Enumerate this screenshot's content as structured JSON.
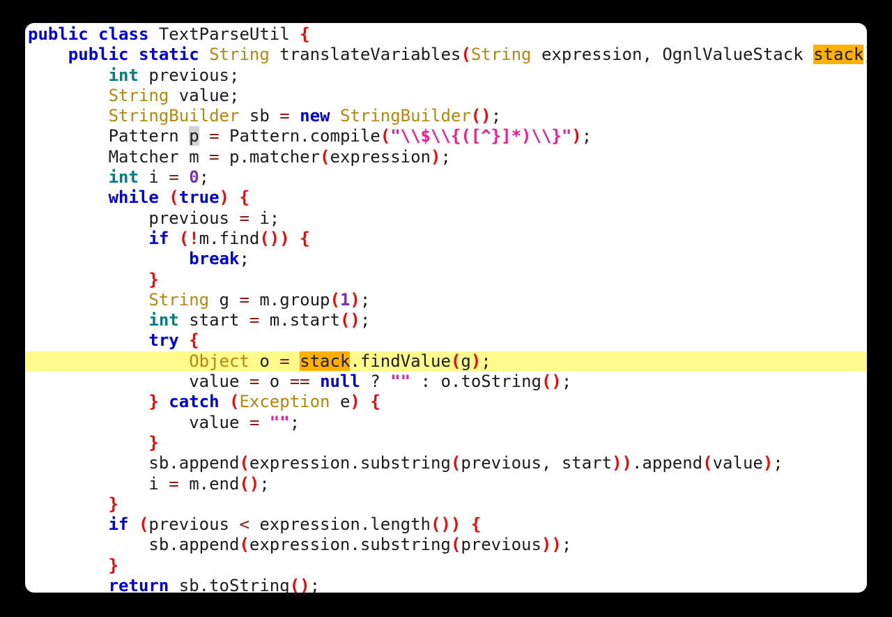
{
  "editor": {
    "language": "Java",
    "class_name": "TextParseUtil",
    "method_name": "translateVariables",
    "caret_character": "p",
    "occurrence_token": "stack",
    "colors": {
      "background": "#000000",
      "card_background": "#ffffff",
      "keyword": "#0000e6",
      "type": "#b8860b",
      "primitive": "#008080",
      "punctuation": "#ff0000",
      "operator": "#8b1a1a",
      "string": "#ff1493",
      "number": "#7b2fbe",
      "plain_text": "#1c1c1c",
      "current_line_highlight": "#fffa8c",
      "occurrence_highlight": "#ffb000",
      "caret_block": "#d2d2d2"
    }
  },
  "code": {
    "lines": [
      {
        "id": "line-1",
        "current": false,
        "tokens": [
          {
            "t": "public",
            "c": "keyword"
          },
          {
            "t": " ",
            "c": "plain"
          },
          {
            "t": "class",
            "c": "keyword"
          },
          {
            "t": " TextParseUtil ",
            "c": "plain"
          },
          {
            "t": "{",
            "c": "punct"
          }
        ]
      },
      {
        "id": "line-2",
        "current": false,
        "tokens": [
          {
            "t": "    ",
            "c": "plain"
          },
          {
            "t": "public",
            "c": "keyword"
          },
          {
            "t": " ",
            "c": "plain"
          },
          {
            "t": "static",
            "c": "keyword"
          },
          {
            "t": " ",
            "c": "plain"
          },
          {
            "t": "String",
            "c": "type"
          },
          {
            "t": " translateVariables",
            "c": "plain"
          },
          {
            "t": "(",
            "c": "punct"
          },
          {
            "t": "String",
            "c": "type"
          },
          {
            "t": " expression, OgnlValueStack ",
            "c": "plain"
          },
          {
            "t": "stack",
            "c": "occurrence"
          },
          {
            "t": ")",
            "c": "punct"
          },
          {
            "t": " ",
            "c": "plain"
          },
          {
            "t": "{",
            "c": "punct"
          }
        ]
      },
      {
        "id": "line-3",
        "current": false,
        "tokens": [
          {
            "t": "        ",
            "c": "plain"
          },
          {
            "t": "int",
            "c": "primitive"
          },
          {
            "t": " previous;",
            "c": "plain"
          }
        ]
      },
      {
        "id": "line-4",
        "current": false,
        "tokens": [
          {
            "t": "        ",
            "c": "plain"
          },
          {
            "t": "String",
            "c": "type"
          },
          {
            "t": " value;",
            "c": "plain"
          }
        ]
      },
      {
        "id": "line-5",
        "current": false,
        "tokens": [
          {
            "t": "        ",
            "c": "plain"
          },
          {
            "t": "StringBuilder",
            "c": "type"
          },
          {
            "t": " sb ",
            "c": "plain"
          },
          {
            "t": "=",
            "c": "operator"
          },
          {
            "t": " ",
            "c": "plain"
          },
          {
            "t": "new",
            "c": "keyword"
          },
          {
            "t": " ",
            "c": "plain"
          },
          {
            "t": "StringBuilder",
            "c": "type"
          },
          {
            "t": "()",
            "c": "punct"
          },
          {
            "t": ";",
            "c": "plain"
          }
        ]
      },
      {
        "id": "line-6",
        "current": false,
        "tokens": [
          {
            "t": "        Pattern ",
            "c": "plain"
          },
          {
            "t": "p",
            "c": "caret"
          },
          {
            "t": " ",
            "c": "plain"
          },
          {
            "t": "=",
            "c": "operator"
          },
          {
            "t": " Pattern.compile",
            "c": "plain"
          },
          {
            "t": "(",
            "c": "punct"
          },
          {
            "t": "\"\\\\$\\\\{([^}]*)\\\\}\"",
            "c": "string"
          },
          {
            "t": ")",
            "c": "punct"
          },
          {
            "t": ";",
            "c": "plain"
          }
        ]
      },
      {
        "id": "line-7",
        "current": false,
        "tokens": [
          {
            "t": "        Matcher m ",
            "c": "plain"
          },
          {
            "t": "=",
            "c": "operator"
          },
          {
            "t": " p.matcher",
            "c": "plain"
          },
          {
            "t": "(",
            "c": "punct"
          },
          {
            "t": "expression",
            "c": "plain"
          },
          {
            "t": ")",
            "c": "punct"
          },
          {
            "t": ";",
            "c": "plain"
          }
        ]
      },
      {
        "id": "line-8",
        "current": false,
        "tokens": [
          {
            "t": "        ",
            "c": "plain"
          },
          {
            "t": "int",
            "c": "primitive"
          },
          {
            "t": " i ",
            "c": "plain"
          },
          {
            "t": "=",
            "c": "operator"
          },
          {
            "t": " ",
            "c": "plain"
          },
          {
            "t": "0",
            "c": "number"
          },
          {
            "t": ";",
            "c": "plain"
          }
        ]
      },
      {
        "id": "line-9",
        "current": false,
        "tokens": [
          {
            "t": "        ",
            "c": "plain"
          },
          {
            "t": "while",
            "c": "keyword"
          },
          {
            "t": " ",
            "c": "plain"
          },
          {
            "t": "(",
            "c": "punct"
          },
          {
            "t": "true",
            "c": "keyword"
          },
          {
            "t": ")",
            "c": "punct"
          },
          {
            "t": " ",
            "c": "plain"
          },
          {
            "t": "{",
            "c": "punct"
          }
        ]
      },
      {
        "id": "line-10",
        "current": false,
        "tokens": [
          {
            "t": "            previous ",
            "c": "plain"
          },
          {
            "t": "=",
            "c": "operator"
          },
          {
            "t": " i;",
            "c": "plain"
          }
        ]
      },
      {
        "id": "line-11",
        "current": false,
        "tokens": [
          {
            "t": "            ",
            "c": "plain"
          },
          {
            "t": "if",
            "c": "keyword"
          },
          {
            "t": " ",
            "c": "plain"
          },
          {
            "t": "(",
            "c": "punct"
          },
          {
            "t": "!",
            "c": "punct"
          },
          {
            "t": "m.find",
            "c": "plain"
          },
          {
            "t": "()",
            "c": "punct"
          },
          {
            "t": ")",
            "c": "punct"
          },
          {
            "t": " ",
            "c": "plain"
          },
          {
            "t": "{",
            "c": "punct"
          }
        ]
      },
      {
        "id": "line-12",
        "current": false,
        "tokens": [
          {
            "t": "                ",
            "c": "plain"
          },
          {
            "t": "break",
            "c": "keyword"
          },
          {
            "t": ";",
            "c": "plain"
          }
        ]
      },
      {
        "id": "line-13",
        "current": false,
        "tokens": [
          {
            "t": "            ",
            "c": "plain"
          },
          {
            "t": "}",
            "c": "punct"
          }
        ]
      },
      {
        "id": "line-14",
        "current": false,
        "tokens": [
          {
            "t": "            ",
            "c": "plain"
          },
          {
            "t": "String",
            "c": "type"
          },
          {
            "t": " g ",
            "c": "plain"
          },
          {
            "t": "=",
            "c": "operator"
          },
          {
            "t": " m.group",
            "c": "plain"
          },
          {
            "t": "(",
            "c": "punct"
          },
          {
            "t": "1",
            "c": "number"
          },
          {
            "t": ")",
            "c": "punct"
          },
          {
            "t": ";",
            "c": "plain"
          }
        ]
      },
      {
        "id": "line-15",
        "current": false,
        "tokens": [
          {
            "t": "            ",
            "c": "plain"
          },
          {
            "t": "int",
            "c": "primitive"
          },
          {
            "t": " start ",
            "c": "plain"
          },
          {
            "t": "=",
            "c": "operator"
          },
          {
            "t": " m.start",
            "c": "plain"
          },
          {
            "t": "()",
            "c": "punct"
          },
          {
            "t": ";",
            "c": "plain"
          }
        ]
      },
      {
        "id": "line-16",
        "current": false,
        "tokens": [
          {
            "t": "            ",
            "c": "plain"
          },
          {
            "t": "try",
            "c": "keyword"
          },
          {
            "t": " ",
            "c": "plain"
          },
          {
            "t": "{",
            "c": "punct"
          }
        ]
      },
      {
        "id": "line-17",
        "current": true,
        "tokens": [
          {
            "t": "                ",
            "c": "plain"
          },
          {
            "t": "Object",
            "c": "type"
          },
          {
            "t": " o ",
            "c": "plain"
          },
          {
            "t": "=",
            "c": "operator"
          },
          {
            "t": " ",
            "c": "plain"
          },
          {
            "t": "stack",
            "c": "occurrence"
          },
          {
            "t": ".findValue",
            "c": "plain"
          },
          {
            "t": "(",
            "c": "punct"
          },
          {
            "t": "g",
            "c": "plain"
          },
          {
            "t": ")",
            "c": "punct"
          },
          {
            "t": ";",
            "c": "plain"
          }
        ]
      },
      {
        "id": "line-18",
        "current": false,
        "tokens": [
          {
            "t": "                value ",
            "c": "plain"
          },
          {
            "t": "=",
            "c": "operator"
          },
          {
            "t": " o ",
            "c": "plain"
          },
          {
            "t": "==",
            "c": "operator"
          },
          {
            "t": " ",
            "c": "plain"
          },
          {
            "t": "null",
            "c": "keyword"
          },
          {
            "t": " ? ",
            "c": "plain"
          },
          {
            "t": "\"\"",
            "c": "string"
          },
          {
            "t": " : o.toString",
            "c": "plain"
          },
          {
            "t": "()",
            "c": "punct"
          },
          {
            "t": ";",
            "c": "plain"
          }
        ]
      },
      {
        "id": "line-19",
        "current": false,
        "tokens": [
          {
            "t": "            ",
            "c": "plain"
          },
          {
            "t": "}",
            "c": "punct"
          },
          {
            "t": " ",
            "c": "plain"
          },
          {
            "t": "catch",
            "c": "keyword"
          },
          {
            "t": " ",
            "c": "plain"
          },
          {
            "t": "(",
            "c": "punct"
          },
          {
            "t": "Exception",
            "c": "type"
          },
          {
            "t": " e",
            "c": "plain"
          },
          {
            "t": ")",
            "c": "punct"
          },
          {
            "t": " ",
            "c": "plain"
          },
          {
            "t": "{",
            "c": "punct"
          }
        ]
      },
      {
        "id": "line-20",
        "current": false,
        "tokens": [
          {
            "t": "                value ",
            "c": "plain"
          },
          {
            "t": "=",
            "c": "operator"
          },
          {
            "t": " ",
            "c": "plain"
          },
          {
            "t": "\"\"",
            "c": "string"
          },
          {
            "t": ";",
            "c": "plain"
          }
        ]
      },
      {
        "id": "line-21",
        "current": false,
        "tokens": [
          {
            "t": "            ",
            "c": "plain"
          },
          {
            "t": "}",
            "c": "punct"
          }
        ]
      },
      {
        "id": "line-22",
        "current": false,
        "tokens": [
          {
            "t": "            sb.append",
            "c": "plain"
          },
          {
            "t": "(",
            "c": "punct"
          },
          {
            "t": "expression.substring",
            "c": "plain"
          },
          {
            "t": "(",
            "c": "punct"
          },
          {
            "t": "previous, start",
            "c": "plain"
          },
          {
            "t": ")",
            "c": "punct"
          },
          {
            "t": ")",
            "c": "punct"
          },
          {
            "t": ".append",
            "c": "plain"
          },
          {
            "t": "(",
            "c": "punct"
          },
          {
            "t": "value",
            "c": "plain"
          },
          {
            "t": ")",
            "c": "punct"
          },
          {
            "t": ";",
            "c": "plain"
          }
        ]
      },
      {
        "id": "line-23",
        "current": false,
        "tokens": [
          {
            "t": "            i ",
            "c": "plain"
          },
          {
            "t": "=",
            "c": "operator"
          },
          {
            "t": " m.end",
            "c": "plain"
          },
          {
            "t": "()",
            "c": "punct"
          },
          {
            "t": ";",
            "c": "plain"
          }
        ]
      },
      {
        "id": "line-24",
        "current": false,
        "tokens": [
          {
            "t": "        ",
            "c": "plain"
          },
          {
            "t": "}",
            "c": "punct"
          }
        ]
      },
      {
        "id": "line-25",
        "current": false,
        "tokens": [
          {
            "t": "        ",
            "c": "plain"
          },
          {
            "t": "if",
            "c": "keyword"
          },
          {
            "t": " ",
            "c": "plain"
          },
          {
            "t": "(",
            "c": "punct"
          },
          {
            "t": "previous ",
            "c": "plain"
          },
          {
            "t": "<",
            "c": "operator"
          },
          {
            "t": " expression.length",
            "c": "plain"
          },
          {
            "t": "()",
            "c": "punct"
          },
          {
            "t": ")",
            "c": "punct"
          },
          {
            "t": " ",
            "c": "plain"
          },
          {
            "t": "{",
            "c": "punct"
          }
        ]
      },
      {
        "id": "line-26",
        "current": false,
        "tokens": [
          {
            "t": "            sb.append",
            "c": "plain"
          },
          {
            "t": "(",
            "c": "punct"
          },
          {
            "t": "expression.substring",
            "c": "plain"
          },
          {
            "t": "(",
            "c": "punct"
          },
          {
            "t": "previous",
            "c": "plain"
          },
          {
            "t": ")",
            "c": "punct"
          },
          {
            "t": ")",
            "c": "punct"
          },
          {
            "t": ";",
            "c": "plain"
          }
        ]
      },
      {
        "id": "line-27",
        "current": false,
        "tokens": [
          {
            "t": "        ",
            "c": "plain"
          },
          {
            "t": "}",
            "c": "punct"
          }
        ]
      },
      {
        "id": "line-28",
        "current": false,
        "tokens": [
          {
            "t": "        ",
            "c": "plain"
          },
          {
            "t": "return",
            "c": "keyword"
          },
          {
            "t": " sb.toString",
            "c": "plain"
          },
          {
            "t": "()",
            "c": "punct"
          },
          {
            "t": ";",
            "c": "plain"
          }
        ]
      }
    ]
  }
}
